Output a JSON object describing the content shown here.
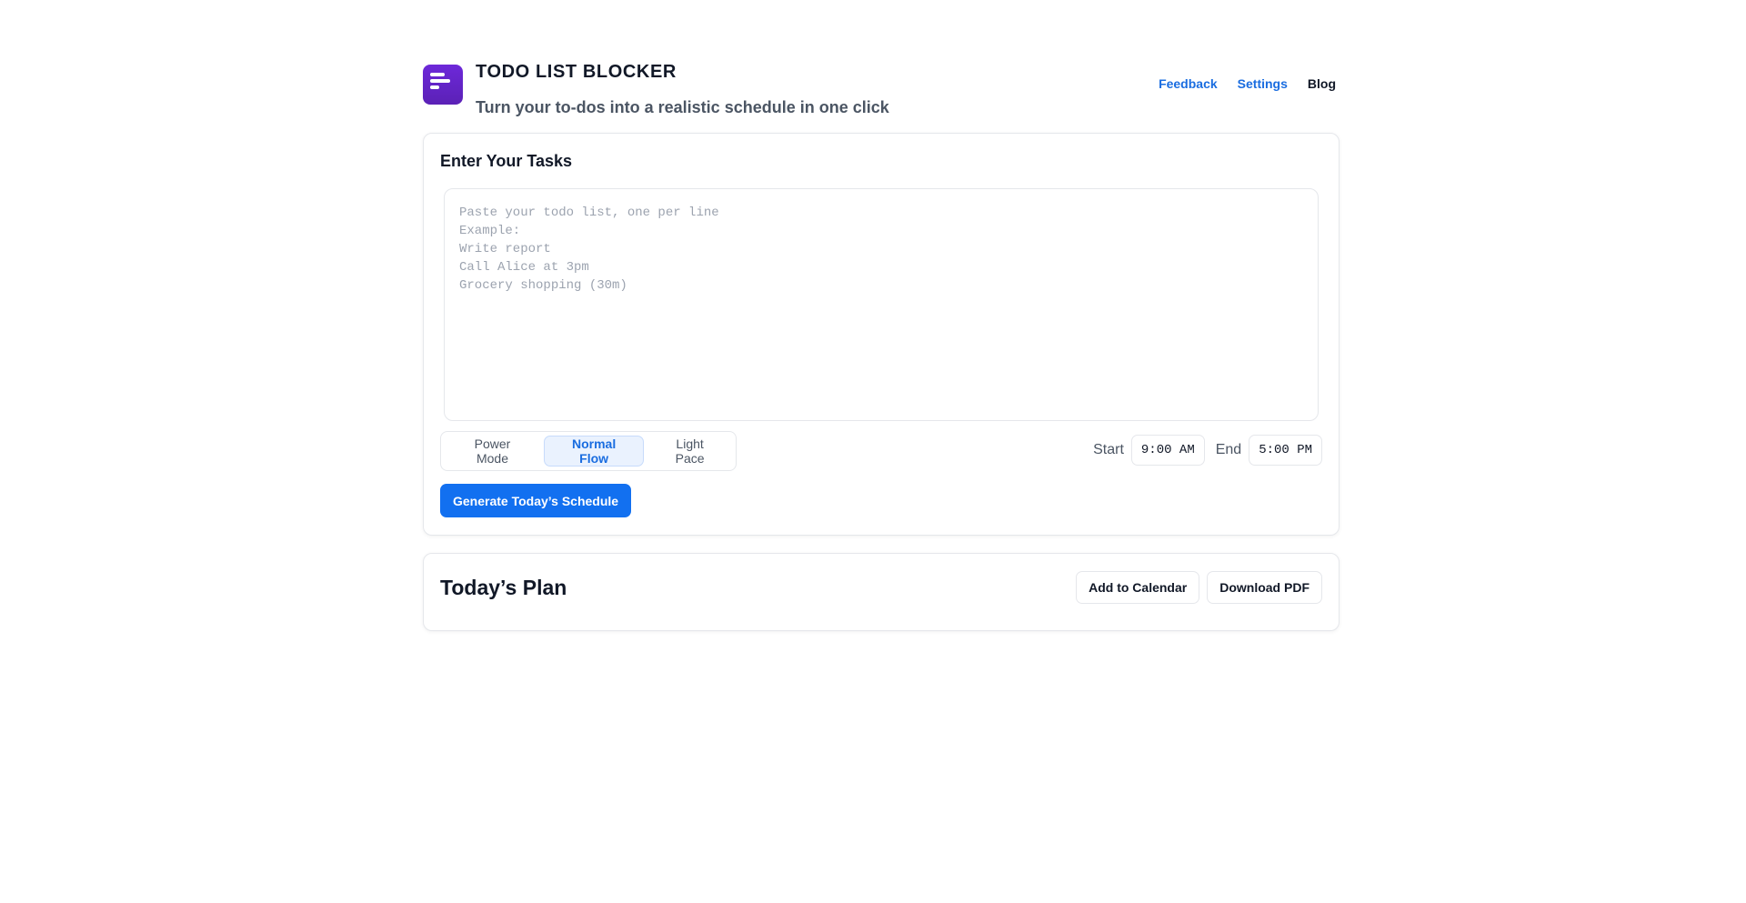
{
  "header": {
    "logo_icon": "list-lines-icon",
    "brand_color": "#5b21b6",
    "title": "TODO LIST BLOCKER",
    "subtitle": "Turn your to-dos into a realistic schedule in one click",
    "nav": {
      "feedback": "Feedback",
      "settings": "Settings",
      "blog": "Blog"
    }
  },
  "tasks": {
    "heading": "Enter Your Tasks",
    "input_value": "",
    "placeholder": "Paste your todo list, one per line\nExample:\nWrite report\nCall Alice at 3pm\nGrocery shopping (30m)",
    "pace": {
      "options": [
        "Power Mode",
        "Normal Flow",
        "Light Pace"
      ],
      "selected": "Normal Flow"
    },
    "start_label": "Start",
    "start_time": "9:00 AM",
    "end_label": "End",
    "end_time": "5:00 PM",
    "generate_label": "Generate Today’s Schedule",
    "accent_color": "#1270f0"
  },
  "plan": {
    "title": "Today’s Plan",
    "add_calendar_label": "Add to Calendar",
    "download_pdf_label": "Download PDF"
  }
}
